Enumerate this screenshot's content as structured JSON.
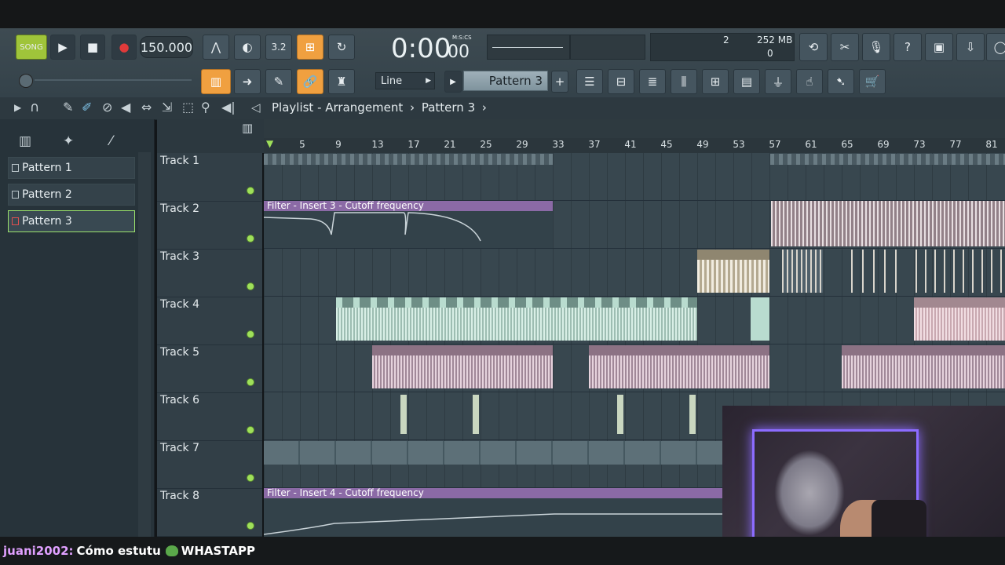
{
  "transport": {
    "song_label": "SONG",
    "tempo": "150.000",
    "time": "0:00",
    "time_sub": "00",
    "time_unit": "M:S:CS"
  },
  "meters": {
    "cpu": "2",
    "mem": "252 MB",
    "poly": "0"
  },
  "snap": {
    "value": "Line"
  },
  "pattern_selector": {
    "label": "Pattern 3"
  },
  "breadcrumb": {
    "text": "Playlist - Arrangement",
    "sep": "›",
    "pattern": "Pattern 3"
  },
  "patterns": [
    "Pattern 1",
    "Pattern 2",
    "Pattern 3"
  ],
  "tracks": [
    "Track 1",
    "Track 2",
    "Track 3",
    "Track 4",
    "Track 5",
    "Track 6",
    "Track 7",
    "Track 8"
  ],
  "ruler": [
    "5",
    "9",
    "13",
    "17",
    "21",
    "25",
    "29",
    "33",
    "37",
    "41",
    "45",
    "49",
    "53",
    "57",
    "61",
    "65",
    "69",
    "73",
    "77",
    "81"
  ],
  "automation": {
    "clip1": "Filter - Insert 3 - Cutoff frequency",
    "clip2": "Filter - Insert 4 - Cutoff frequency"
  },
  "chat": {
    "user": "juani2002:",
    "message": "Cómo estutu",
    "suffix": "WHASTAPP"
  },
  "colors": {
    "accent_orange": "#f0a040",
    "automation_purple": "#8b6aa6",
    "clip_mint": "#b9dccf",
    "clip_pink": "#c8a8b8",
    "track_dot": "#9fe05a",
    "chat_user": "#e0a0ff"
  }
}
